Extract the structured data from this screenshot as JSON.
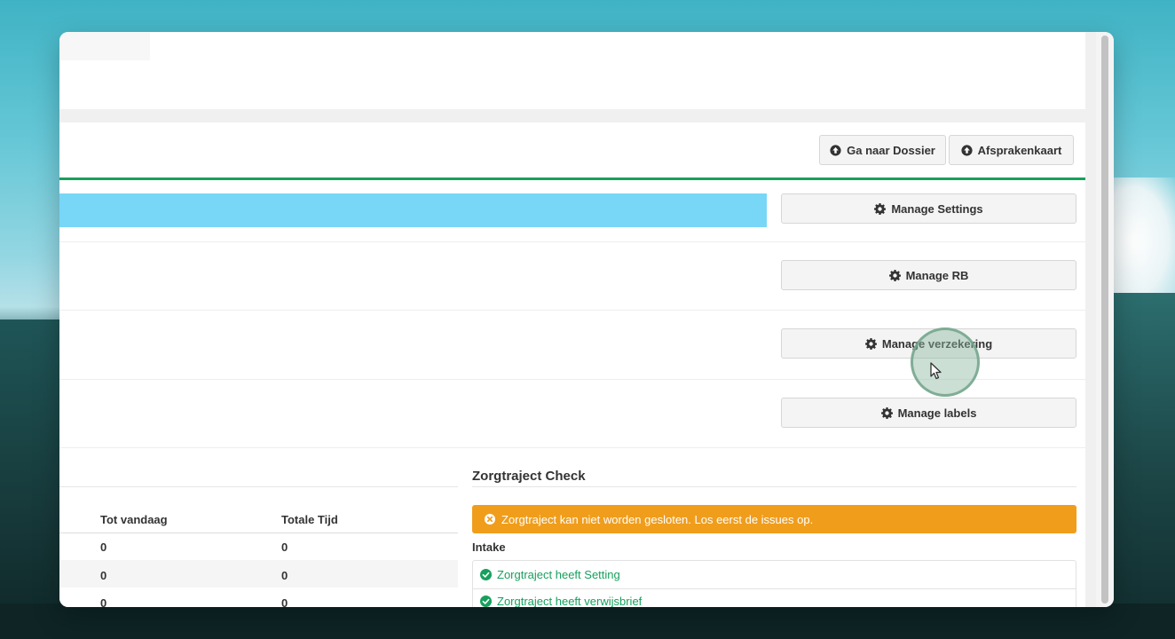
{
  "toolbar": {
    "dossier_label": "Ga naar Dossier",
    "afspraken_label": "Afsprakenkaart"
  },
  "manage": {
    "settings_label": "Manage Settings",
    "rb_label": "Manage RB",
    "verzekering_label": "Manage verzekering",
    "labels_label": "Manage labels"
  },
  "table": {
    "headers": [
      "Tot vandaag",
      "Totale Tijd"
    ],
    "rows": [
      [
        "0",
        "0"
      ],
      [
        "0",
        "0"
      ],
      [
        "0",
        "0"
      ]
    ]
  },
  "zorgtraject": {
    "title": "Zorgtraject Check",
    "alert_text": "Zorgtraject kan niet worden gesloten. Los eerst de issues op.",
    "section": "Intake",
    "checks": [
      "Zorgtraject heeft Setting",
      "Zorgtraject heeft verwijsbrief"
    ]
  },
  "colors": {
    "accent_green": "#17a05d",
    "alert_orange": "#f09d1b",
    "progress_blue": "#78d6f7"
  }
}
